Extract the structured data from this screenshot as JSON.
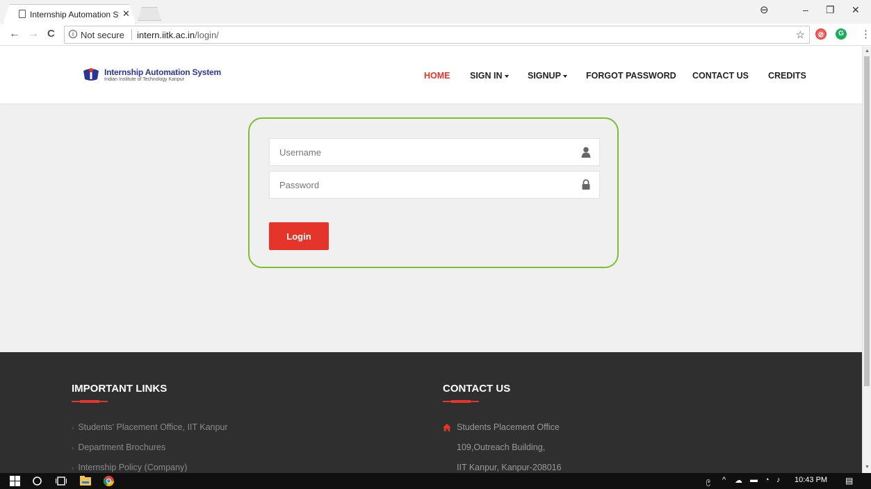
{
  "browser": {
    "tab_title": "Internship Automation Sy",
    "security_label": "Not secure",
    "url_host": "intern.iitk.ac.in",
    "url_path": "/login/"
  },
  "site": {
    "brand_name": "Internship Automation System",
    "brand_sub": "Indian Institute of Technology Kanpur",
    "nav": {
      "home": "HOME",
      "sign_in": "SIGN IN",
      "signup": "SIGNUP",
      "forgot": "FORGOT PASSWORD",
      "contact": "CONTACT US",
      "credits": "CREDITS"
    }
  },
  "login": {
    "username_placeholder": "Username",
    "password_placeholder": "Password",
    "button_label": "Login"
  },
  "footer": {
    "links_heading": "IMPORTANT LINKS",
    "links": [
      "Students' Placement Office, IIT Kanpur",
      "Department Brochures",
      "Internship Policy (Company)"
    ],
    "contact_heading": "CONTACT US",
    "contact": [
      "Students Placement Office",
      "109,Outreach Building,",
      "IIT Kanpur, Kanpur-208016"
    ]
  },
  "taskbar": {
    "time": "10:43 PM"
  },
  "colors": {
    "accent_red": "#e5352b",
    "card_border_green": "#7cbf2e",
    "brand_blue": "#2c3594",
    "footer_bg": "#2f2f2f"
  },
  "icons": [
    "page-icon",
    "close-icon",
    "back-icon",
    "forward-icon",
    "reload-icon",
    "info-icon",
    "star-icon",
    "user-icon",
    "lock-icon",
    "home-icon",
    "windows-icon",
    "search-icon",
    "task-view-icon",
    "file-explorer-icon",
    "chrome-icon"
  ]
}
